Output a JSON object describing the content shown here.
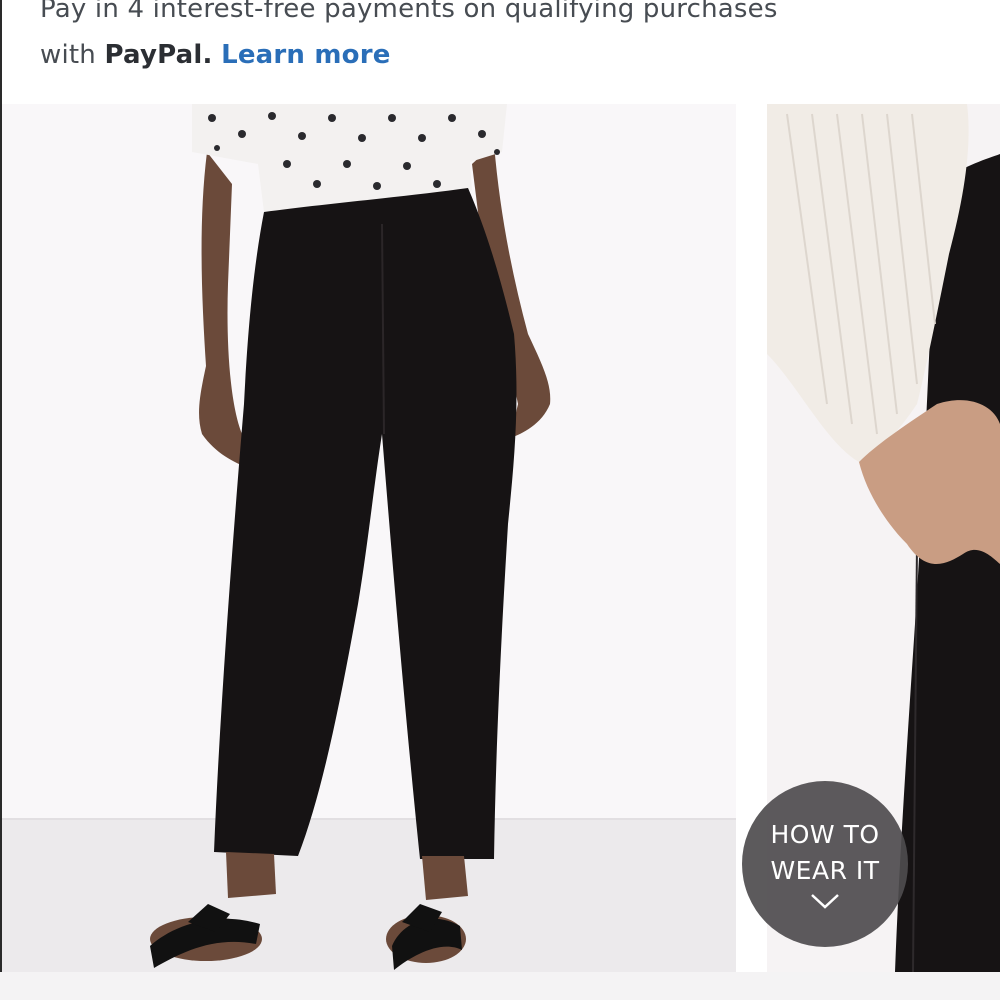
{
  "paypal": {
    "line1": "Pay in 4 interest-free payments on qualifying purchases",
    "line2_prefix": "with",
    "brand": "PayPal.",
    "link": "Learn more"
  },
  "gallery": {
    "images": [
      {
        "icon": "product-photo-front-view"
      },
      {
        "icon": "product-photo-pocket-detail"
      }
    ]
  },
  "how_to_wear": {
    "line1": "HOW TO",
    "line2": "WEAR IT",
    "icon": "chevron-down-icon"
  },
  "colors": {
    "link": "#2a6eb8",
    "text": "#474c52",
    "badge": "#4e4c4e",
    "pants": "#161314"
  }
}
